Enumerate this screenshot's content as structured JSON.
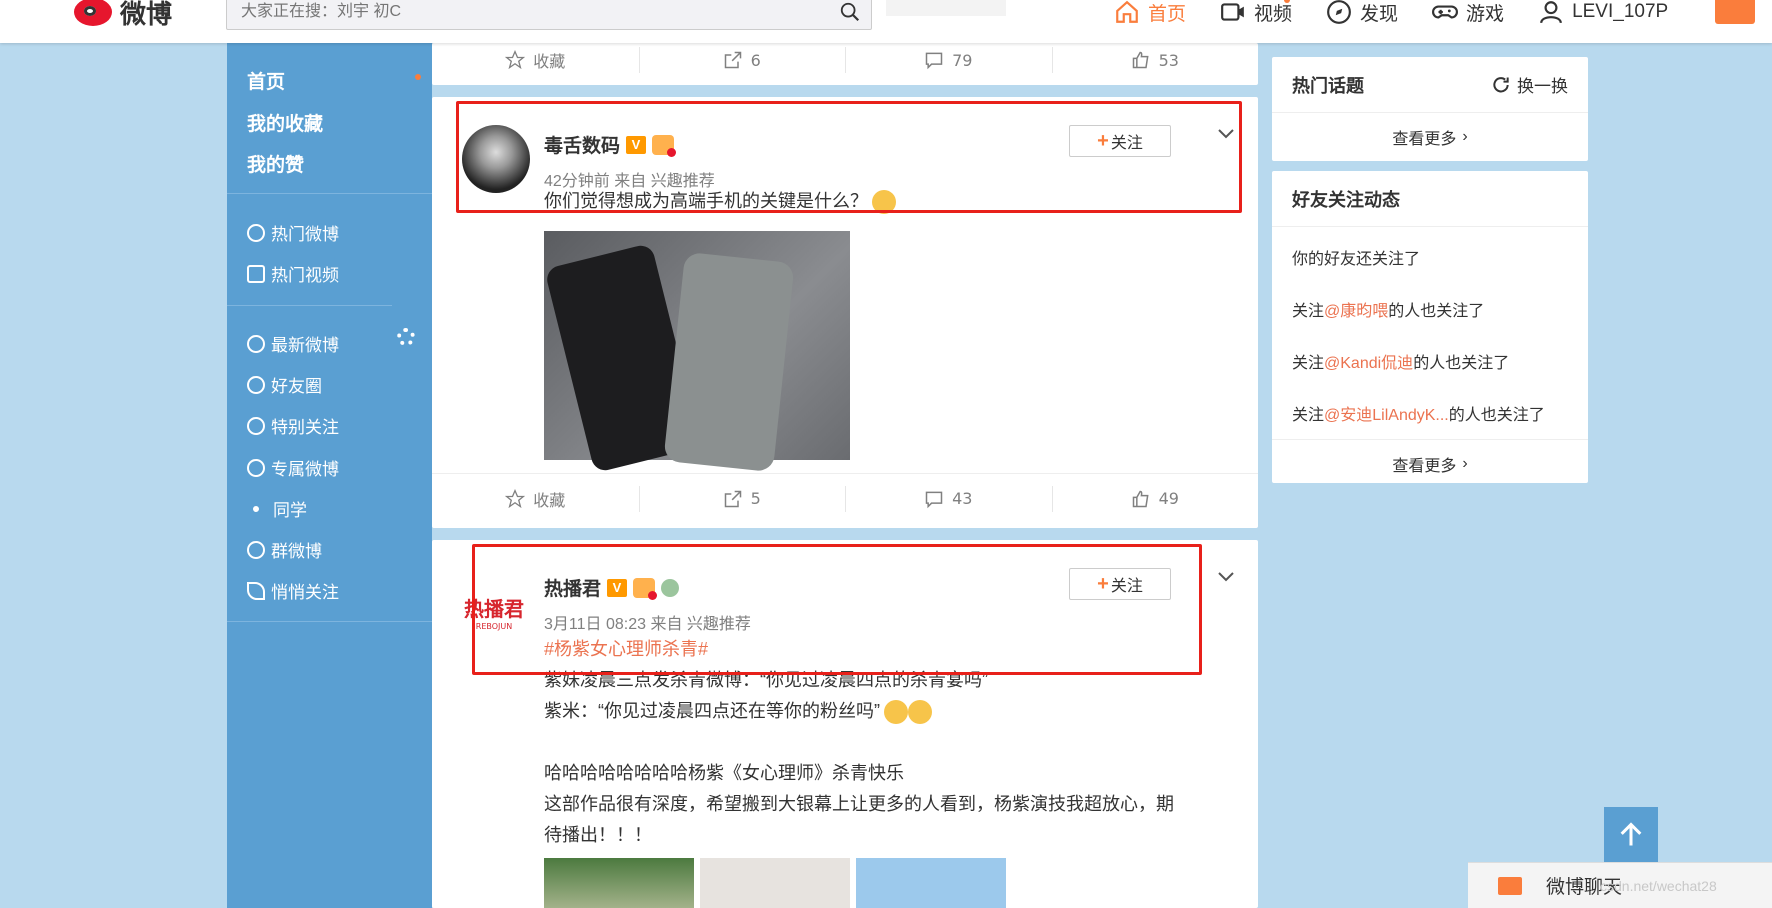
{
  "header": {
    "logo_text": "微博",
    "search_placeholder": "大家正在搜：刘宇 初C",
    "nav": [
      {
        "label": "首页",
        "icon": "home-icon",
        "active": true
      },
      {
        "label": "视频",
        "icon": "video-icon"
      },
      {
        "label": "发现",
        "icon": "compass-icon"
      },
      {
        "label": "游戏",
        "icon": "gamepad-icon"
      },
      {
        "label": "LEVI_107P",
        "icon": "user-icon"
      }
    ]
  },
  "sidebar": {
    "main_items": [
      "首页",
      "我的收藏",
      "我的赞"
    ],
    "hot_items": [
      "热门微博",
      "热门视频"
    ],
    "group_items": [
      "最新微博",
      "好友圈",
      "特别关注",
      "专属微博",
      "同学",
      "群微博",
      "悄悄关注"
    ]
  },
  "post0_actions": {
    "fav": "收藏",
    "repost": "6",
    "comment": "79",
    "like": "53"
  },
  "post1": {
    "username": "毒舌数码",
    "meta": "42分钟前 来自 兴趣推荐",
    "text": "你们觉得想成为高端手机的关键是什么？",
    "follow": "关注",
    "actions": {
      "fav": "收藏",
      "repost": "5",
      "comment": "43",
      "like": "49"
    }
  },
  "post2": {
    "username": "热播君",
    "avatar_text": "热播君",
    "avatar_sub": "REBOJUN",
    "meta": "3月11日 08:23 来自 兴趣推荐",
    "topic": "#杨紫女心理师杀青#",
    "lines": [
      "紫妹凌晨三点发杀青微博：“你见过凌晨四点的杀青宴吗”",
      "紫米：“你见过凌晨四点还在等你的粉丝吗”",
      "",
      "哈哈哈哈哈哈哈哈杨紫《女心理师》杀青快乐",
      "这部作品很有深度，希望搬到大银幕上让更多的人看到，杨紫演技我超放心，期",
      "待播出！！！"
    ],
    "follow": "关注"
  },
  "right": {
    "hot_topics": {
      "title": "热门话题",
      "refresh": "换一换",
      "more": "查看更多"
    },
    "friends": {
      "title": "好友关注动态",
      "line0": "你的好友还关注了",
      "items": [
        {
          "prefix": "关注",
          "link": "@康昀喂",
          "suffix": "的人也关注了"
        },
        {
          "prefix": "关注",
          "link": "@Kandi侃迪",
          "suffix": "的人也关注了"
        },
        {
          "prefix": "关注",
          "link": "@安迪LilAndyK...",
          "suffix": "的人也关注了"
        }
      ],
      "more": "查看更多"
    }
  },
  "chat": {
    "label": "微博聊天"
  },
  "watermark": "csdn.net/wechat28",
  "colors": {
    "accent": "#fa7d3c",
    "sidebar": "#5a9fd2",
    "background": "#b8d9ee",
    "highlight_box": "#e8201a",
    "link": "#eb7350"
  }
}
